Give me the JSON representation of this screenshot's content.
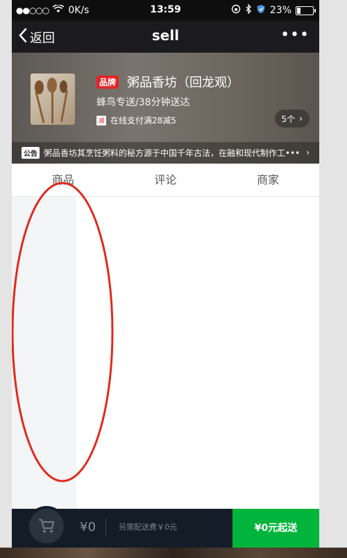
{
  "status_bar": {
    "carrier_signal": "●●○○○",
    "network_speed": "0K/s",
    "time": "13:59",
    "battery_percent": "23%",
    "battery_level": 0.23
  },
  "nav": {
    "back_label": "返回",
    "title": "sell",
    "more_label": "•••"
  },
  "shop": {
    "brand_badge": "品牌",
    "name": "粥品香坊（回龙观）",
    "delivery": "蜂鸟专送/38分钟送达",
    "promo_tag": "减",
    "promo_text": "在线支付满28减5",
    "promo_count": "5个",
    "notice_label": "公告",
    "notice_text": "粥品香坊其烹饪粥料的秘方源于中国千年古法，在融和现代制作工•••"
  },
  "tabs": [
    "商品",
    "评论",
    "商家"
  ],
  "cart": {
    "price": "¥0",
    "delivery_fee": "另需配送费￥0元",
    "min_order": "¥0元起送"
  },
  "colors": {
    "header_dark": "#1b1b1d",
    "brand_red": "#e0252b",
    "cart_bg": "#141d27",
    "pay_green": "#00b43c",
    "annotation_red": "#e02a1e"
  }
}
